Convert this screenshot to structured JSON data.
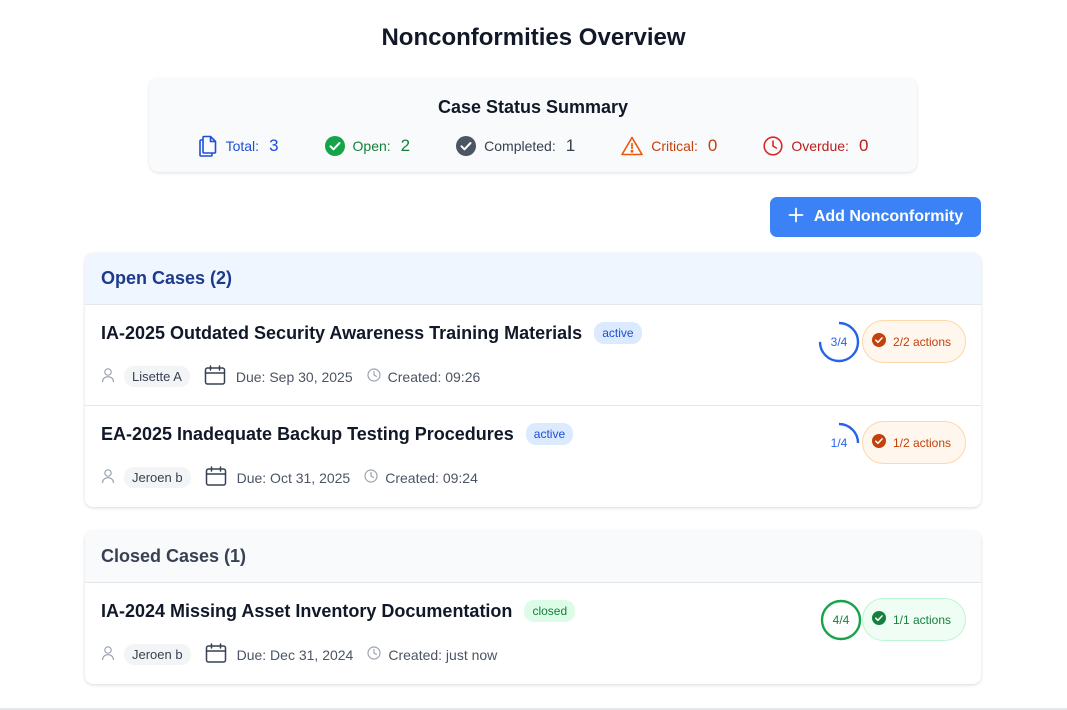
{
  "page": {
    "title": "Nonconformities Overview"
  },
  "summary": {
    "title": "Case Status Summary",
    "stats": [
      {
        "label": "Total:",
        "value": "3",
        "color": "#1d4ed8"
      },
      {
        "label": "Open:",
        "value": "2",
        "color": "#15803d"
      },
      {
        "label": "Completed:",
        "value": "1",
        "color": "#374151"
      },
      {
        "label": "Critical:",
        "value": "0",
        "color": "#c2410c"
      },
      {
        "label": "Overdue:",
        "value": "0",
        "color": "#b91c1c"
      }
    ]
  },
  "toolbar": {
    "add_label": "Add Nonconformity"
  },
  "open_section": {
    "title": "Open Cases (2)",
    "cases": [
      {
        "title": "IA-2025 Outdated Security Awareness Training Materials",
        "status": "active",
        "user": "Lisette A",
        "due": "Due: Sep 30, 2025",
        "created": "Created: 09:26",
        "progress": "3/4",
        "progress_fraction": 0.75,
        "actions": "2/2 actions"
      },
      {
        "title": "EA-2025 Inadequate Backup Testing Procedures",
        "status": "active",
        "user": "Jeroen b",
        "due": "Due: Oct 31, 2025",
        "created": "Created: 09:24",
        "progress": "1/4",
        "progress_fraction": 0.25,
        "actions": "1/2 actions"
      }
    ]
  },
  "closed_section": {
    "title": "Closed Cases (1)",
    "cases": [
      {
        "title": "IA-2024 Missing Asset Inventory Documentation",
        "status": "closed",
        "user": "Jeroen b",
        "due": "Due: Dec 31, 2024",
        "created": "Created: just now",
        "progress": "4/4",
        "progress_fraction": 1.0,
        "actions": "1/1 actions"
      }
    ]
  },
  "colors": {
    "accent": "#3b82f6",
    "active_ring": "#2563eb",
    "closed_ring": "#16a34a",
    "pending": "#c2410c",
    "done": "#15803d"
  }
}
